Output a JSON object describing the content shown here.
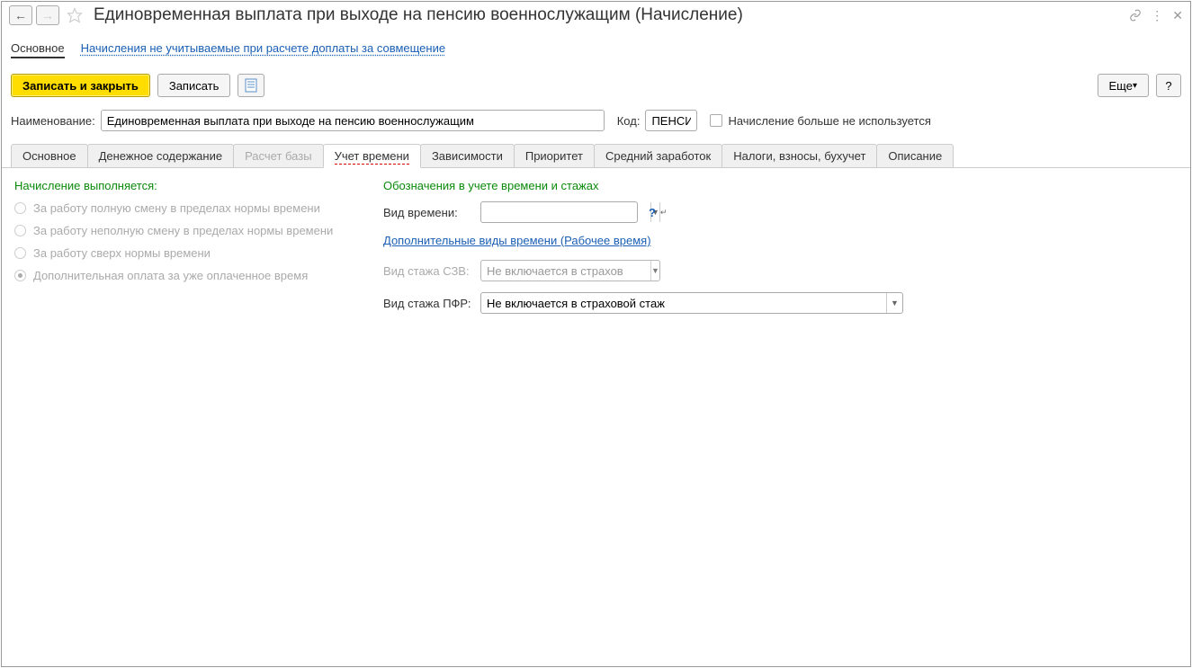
{
  "title": "Единовременная выплата при выходе на пенсию военнослужащим (Начисление)",
  "sectionTabs": {
    "main": "Основное",
    "link": "Начисления не учитываемые при расчете доплаты за совмещение"
  },
  "toolbar": {
    "saveClose": "Записать и закрыть",
    "save": "Записать",
    "more": "Еще",
    "help": "?"
  },
  "form": {
    "nameLabel": "Наименование:",
    "nameValue": "Единовременная выплата при выходе на пенсию военнослужащим",
    "codeLabel": "Код:",
    "codeValue": "ПЕНСИ",
    "unusedLabel": "Начисление больше не используется"
  },
  "tabs": {
    "t0": "Основное",
    "t1": "Денежное содержание",
    "t2": "Расчет базы",
    "t3": "Учет времени",
    "t4": "Зависимости",
    "t5": "Приоритет",
    "t6": "Средний заработок",
    "t7": "Налоги, взносы, бухучет",
    "t8": "Описание"
  },
  "left": {
    "header": "Начисление выполняется:",
    "r0": "За работу полную смену в пределах нормы времени",
    "r1": "За работу неполную смену в пределах нормы времени",
    "r2": "За работу сверх нормы времени",
    "r3": "Дополнительная оплата за уже оплаченное время"
  },
  "right": {
    "header": "Обозначения в учете времени и стажах",
    "vidVremeniLabel": "Вид времени:",
    "vidVremeniValue": "",
    "dopLink": "Дополнительные виды времени (Рабочее время)",
    "stazSzvLabel": "Вид стажа СЗВ:",
    "stazSzvValue": "Не включается в страхов",
    "stazPfrLabel": "Вид стажа ПФР:",
    "stazPfrValue": "Не включается в страховой стаж"
  }
}
